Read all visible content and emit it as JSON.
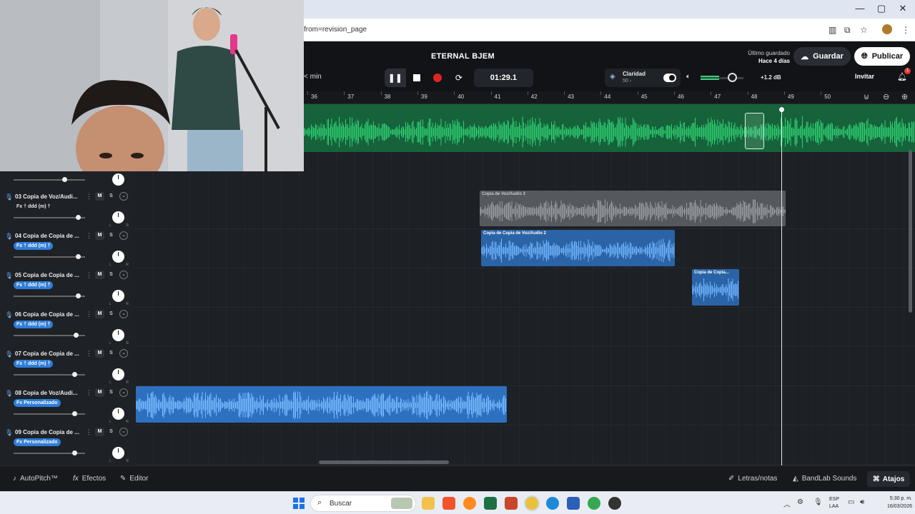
{
  "browser": {
    "url": "from=revision_page",
    "window_controls": [
      "—",
      "▢",
      "✕"
    ]
  },
  "header": {
    "project_title": "ETERNAL BJEM",
    "last_saved_label": "Último guardado",
    "last_saved_time": "Hace 4 días",
    "save_label": "Guardar",
    "publish_label": "Publicar",
    "min_label": "< min",
    "time": "01:29.1",
    "clarity_label": "Claridad",
    "clarity_value": "50 ›",
    "volume_db": "+1.2 dB",
    "invite_label": "Invitar",
    "notification_count": "1"
  },
  "ruler": {
    "marks": [
      "36",
      "37",
      "38",
      "39",
      "40",
      "41",
      "42",
      "43",
      "44",
      "45",
      "46",
      "47",
      "48",
      "49",
      "50"
    ]
  },
  "tracks": [
    {
      "name": "03 Copia de Voz/Audi...",
      "fx": "Fx † ddd (m) †",
      "fx_style": "plain",
      "m": "M",
      "s": "S",
      "vol": 0.9
    },
    {
      "name": "04 Copia de Copia de ...",
      "fx": "Fx † ddd (m) †",
      "fx_style": "blue",
      "m": "M",
      "s": "S",
      "vol": 0.9
    },
    {
      "name": "05 Copia de Copia de ...",
      "fx": "Fx † ddd (m) †",
      "fx_style": "blue",
      "m": "M",
      "s": "S",
      "vol": 0.9
    },
    {
      "name": "06 Copia de Copia de ...",
      "fx": "Fx † ddd (m) †",
      "fx_style": "blue",
      "m": "M",
      "s": "S",
      "vol": 0.87
    },
    {
      "name": "07 Copia de Copia de ...",
      "fx": "Fx † ddd (m) †",
      "fx_style": "blue",
      "m": "M",
      "s": "S",
      "vol": 0.85
    },
    {
      "name": "08 Copia de Voz/Audi...",
      "fx": "Fx Personalizado",
      "fx_style": "blue",
      "m": "M",
      "s": "S",
      "vol": 0.85
    },
    {
      "name": "09 Copia de Copia de ...",
      "fx": "Fx Personalizado",
      "fx_style": "blue",
      "m": "M",
      "s": "S",
      "vol": 0.85
    }
  ],
  "clips": {
    "clip_03": "Copia de Voz/Audio 3",
    "clip_04": "Copia de Copia de Voz/Audio 2",
    "clip_05": "Copia de Copia..."
  },
  "pan": {
    "left": "L",
    "right": "R"
  },
  "bottom_bar": {
    "autopitch": "AutoPitch™",
    "effects": "Efectos",
    "editor": "Editor",
    "lyrics": "Letras/notas",
    "sounds": "BandLab Sounds",
    "shortcuts": "Atajos"
  },
  "taskbar": {
    "search_placeholder": "Buscar",
    "lang1": "ESP",
    "lang2": "LAA",
    "time": "5:30 p. m.",
    "date": "16/03/2026"
  },
  "colors": {
    "accent_green": "#2ecf72",
    "clip_blue": "#2f6fb5",
    "clip_gray": "#5c5f64",
    "record_red": "#e02424"
  }
}
